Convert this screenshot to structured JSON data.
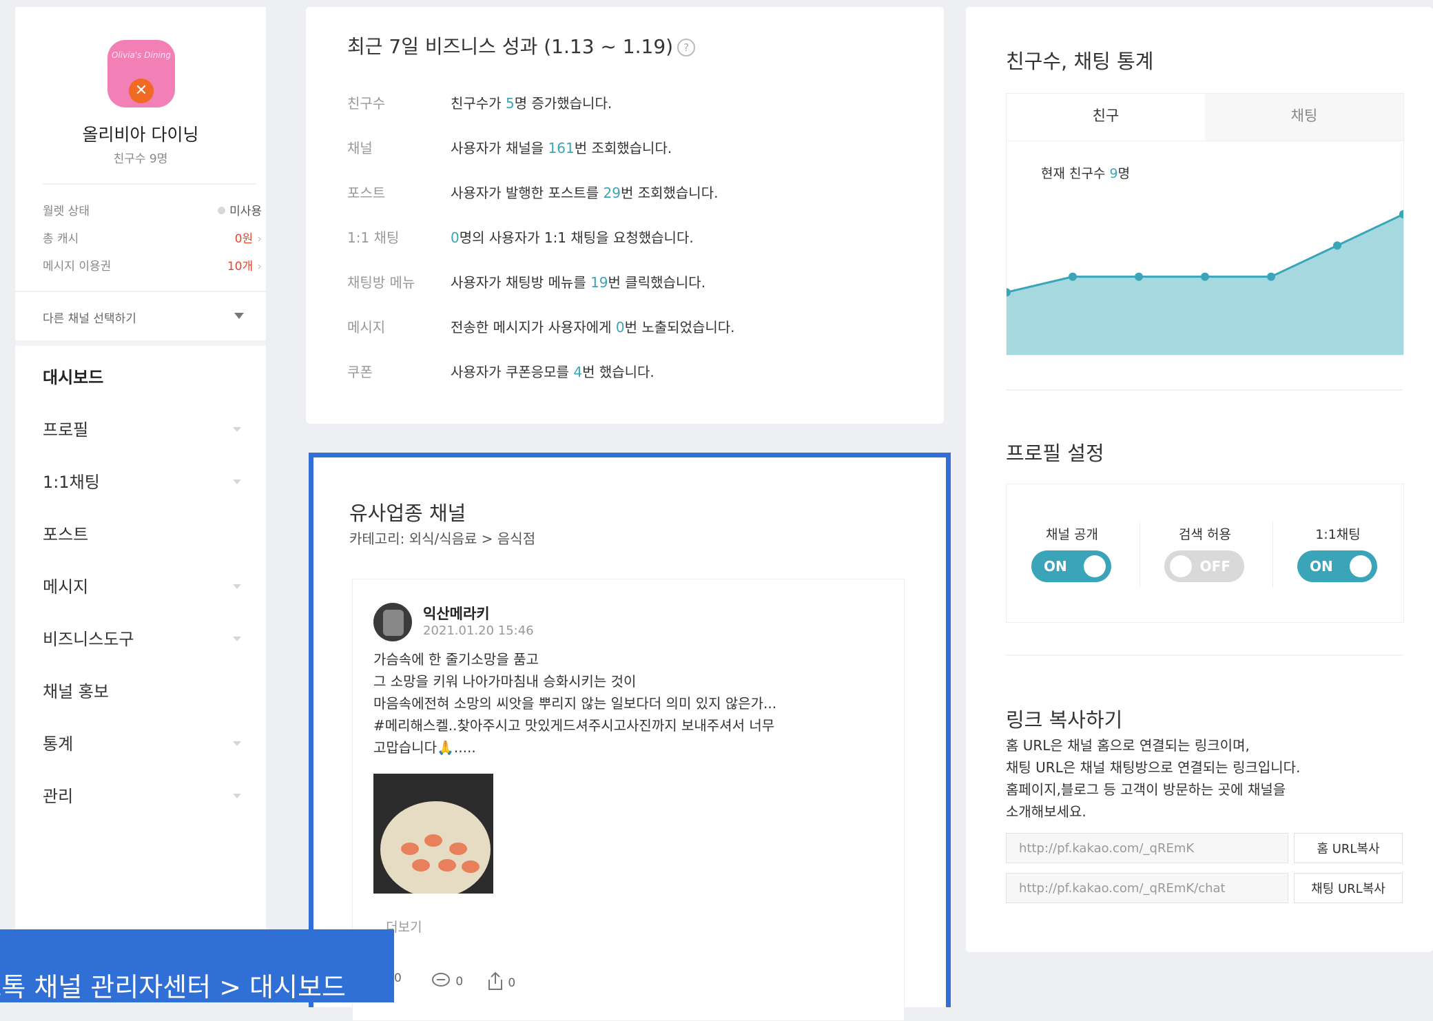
{
  "sidebar": {
    "logo_text": "Olivia's Dining",
    "channel_name": "올리비아 다이닝",
    "friends": "친구수  9명",
    "info": [
      {
        "label": "월렛 상태",
        "value": "미사용"
      },
      {
        "label": "총 캐시",
        "value": "0원"
      },
      {
        "label": "메시지 이용권",
        "value": "10개"
      }
    ],
    "other_channel": "다른 채널 선택하기",
    "nav": [
      "대시보드",
      "프로필",
      "1:1채팅",
      "포스트",
      "메시지",
      "비즈니스도구",
      "채널 홍보",
      "통계",
      "관리"
    ]
  },
  "performance": {
    "title": "최근 7일 비즈니스 성과 (1.13 ~ 1.19)",
    "help": "?",
    "rows": [
      {
        "label": "친구수",
        "pre": "친구수가 ",
        "num": "5",
        "post": "명 증가했습니다."
      },
      {
        "label": "채널",
        "pre": "사용자가 채널을 ",
        "num": "161",
        "post": "번 조회했습니다."
      },
      {
        "label": "포스트",
        "pre": "사용자가 발행한 포스트를 ",
        "num": "29",
        "post": "번 조회했습니다."
      },
      {
        "label": "1:1 채팅",
        "pre": "",
        "num": "0",
        "post": "명의 사용자가 1:1 채팅을 요청했습니다."
      },
      {
        "label": "채팅방 메뉴",
        "pre": "사용자가 채팅방 메뉴를 ",
        "num": "19",
        "post": "번 클릭했습니다."
      },
      {
        "label": "메시지",
        "pre": "전송한 메시지가 사용자에게 ",
        "num": "0",
        "post": "번 노출되었습니다."
      },
      {
        "label": "쿠폰",
        "pre": "사용자가 쿠폰응모를 ",
        "num": "4",
        "post": "번 했습니다."
      }
    ]
  },
  "similar": {
    "title": "유사업종 채널",
    "category": "카테고리: 외식/식음료 > 음식점",
    "post": {
      "author": "익산메라키",
      "date": "2021.01.20 15:46",
      "lines": [
        "가슴속에 한 줄기소망을 품고",
        "그 소망을 키워 나아가마침내 승화시키는 것이",
        "마음속에전혀 소망의 씨앗을 뿌리지 않는 일보다더 의미 있지 않은가...",
        "#메리해스켈..찾아주시고 맛있게드셔주시고사진까지 보내주셔서 너무",
        "고맙습니다🙏....."
      ],
      "more": "...더보기",
      "likes": "0",
      "comments": "0",
      "shares": "0"
    }
  },
  "stats": {
    "title": "친구수, 채팅 통계",
    "tabs": [
      "친구",
      "채팅"
    ],
    "current_pre": "현재 친구수 ",
    "current_num": "9",
    "current_post": "명",
    "color": "#3aa4b8"
  },
  "chart_data": {
    "type": "area",
    "title": "",
    "xlabel": "",
    "ylabel": "",
    "series": [
      {
        "values": [
          4,
          5,
          5,
          5,
          5,
          7,
          9
        ]
      }
    ],
    "ylim": [
      0,
      12
    ],
    "grid": false
  },
  "profile": {
    "title": "프로필 설정",
    "toggles": [
      {
        "label": "채널 공개",
        "state": "ON"
      },
      {
        "label": "검색 허용",
        "state": "OFF"
      },
      {
        "label": "1:1채팅",
        "state": "ON"
      }
    ]
  },
  "link": {
    "title": "링크 복사하기",
    "desc": [
      "홈 URL은 채널 홈으로 연결되는 링크이며,",
      "채팅 URL은 채널 채팅방으로 연결되는 링크입니다.",
      "홈페이지,블로그 등 고객이 방문하는 곳에 채널을",
      "소개해보세요."
    ],
    "home_url": "http://pf.kakao.com/_qREmK",
    "home_btn": "홈 URL복사",
    "chat_url": "http://pf.kakao.com/_qREmK/chat",
    "chat_btn": "채팅 URL복사"
  },
  "caption": "카카오톡 채널 관리자센터 > 대시보드"
}
